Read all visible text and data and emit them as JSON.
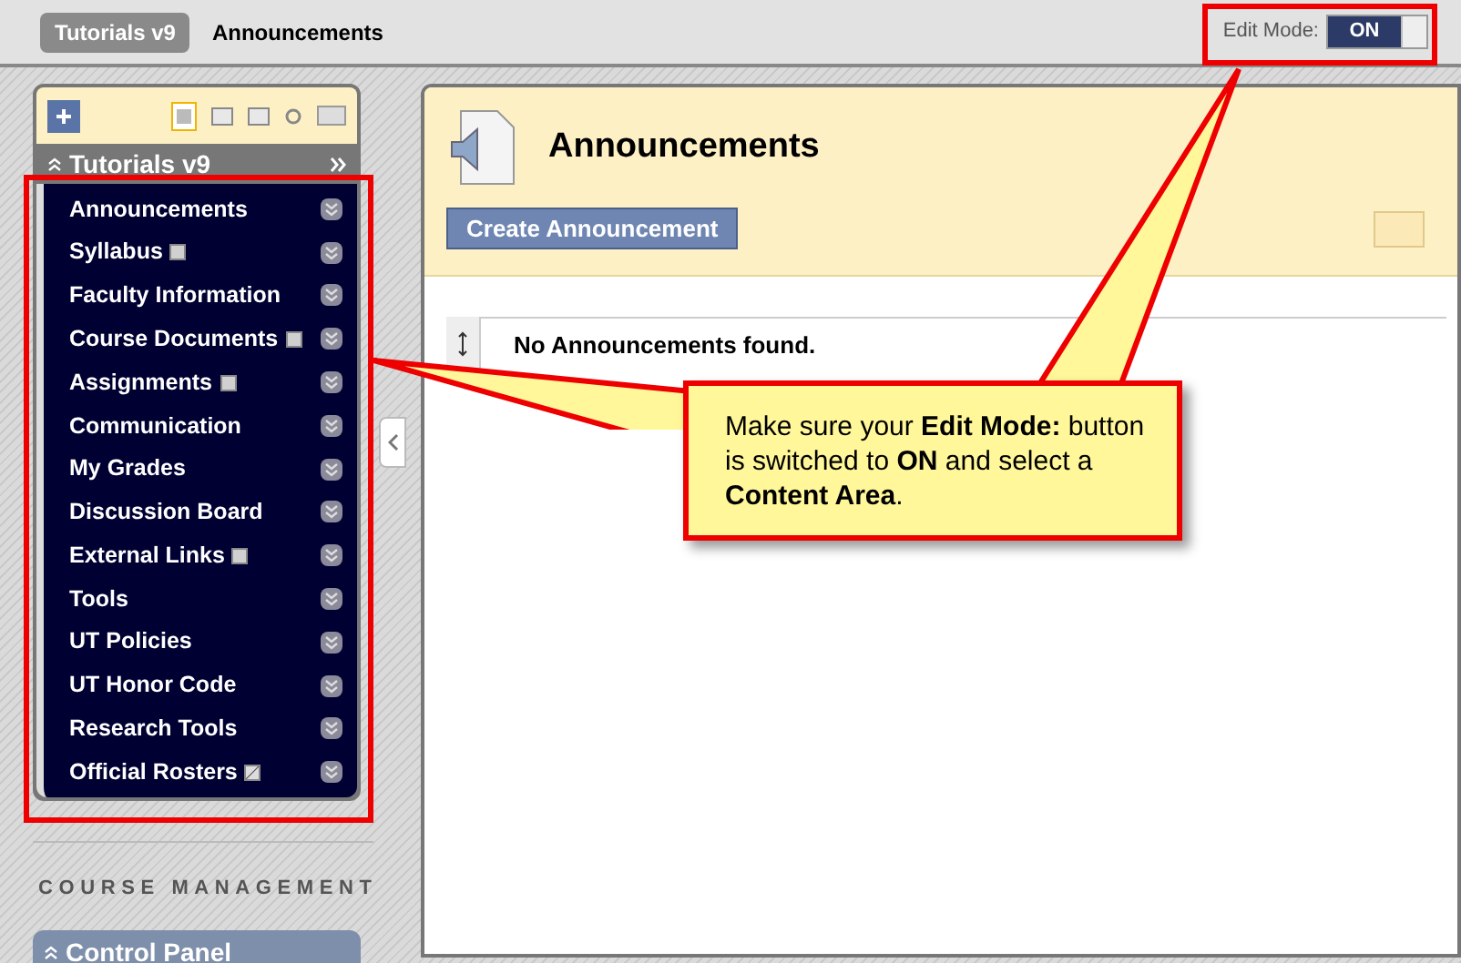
{
  "breadcrumb": [
    {
      "label": "Tutorials v9",
      "selected": false
    },
    {
      "label": "Announcements",
      "selected": true
    }
  ],
  "edit_mode": {
    "label": "Edit Mode:",
    "value": "ON",
    "on": true
  },
  "course_menu": {
    "title": "Tutorials v9",
    "items": [
      {
        "label": "Announcements",
        "kind": "plain"
      },
      {
        "label": "Syllabus",
        "kind": "content"
      },
      {
        "label": "Faculty Information",
        "kind": "plain"
      },
      {
        "label": "Course Documents",
        "kind": "content"
      },
      {
        "label": "Assignments",
        "kind": "content"
      },
      {
        "label": "Communication",
        "kind": "plain"
      },
      {
        "label": "My Grades",
        "kind": "plain"
      },
      {
        "label": "Discussion Board",
        "kind": "plain"
      },
      {
        "label": "External Links",
        "kind": "content"
      },
      {
        "label": "Tools",
        "kind": "plain"
      },
      {
        "label": "UT Policies",
        "kind": "plain"
      },
      {
        "label": "UT Honor Code",
        "kind": "plain"
      },
      {
        "label": "Research Tools",
        "kind": "plain"
      },
      {
        "label": "Official Rosters",
        "kind": "link"
      }
    ]
  },
  "course_management": {
    "heading": "COURSE MANAGEMENT",
    "control_panel": "Control Panel"
  },
  "page": {
    "title": "Announcements",
    "create_button": "Create Announcement",
    "empty_message": "No Announcements found."
  },
  "callout": {
    "text": "Make sure your **Edit Mode:** button is switched to **ON** and select a **Content Area**."
  }
}
